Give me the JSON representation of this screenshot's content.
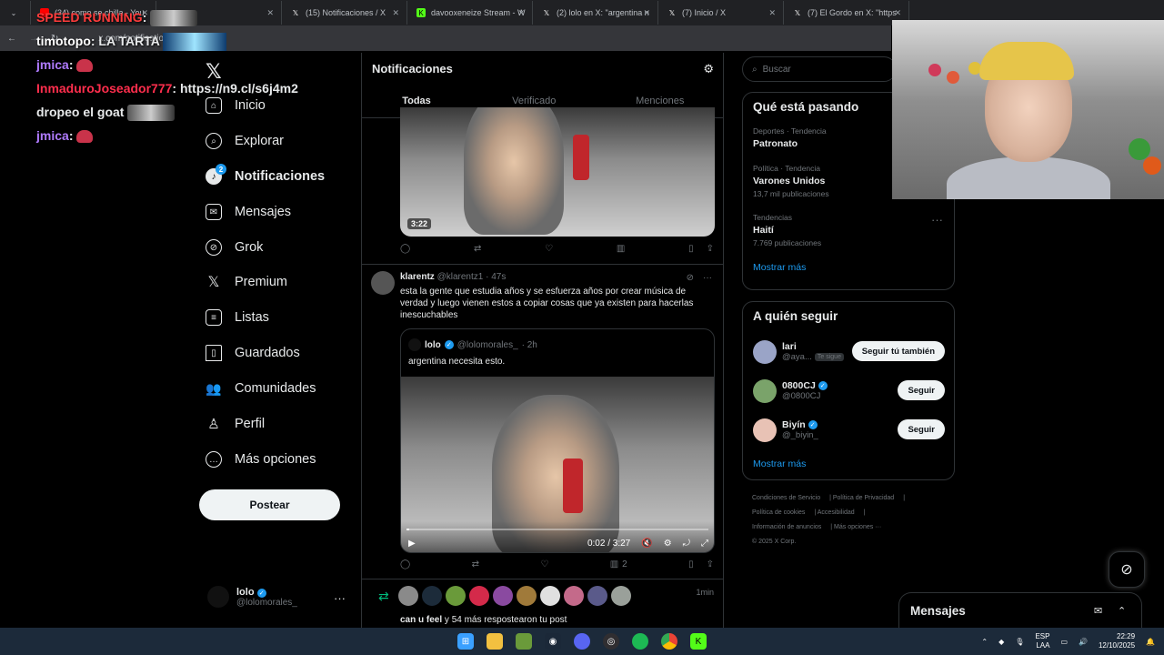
{
  "browser": {
    "tabs": [
      {
        "title": "(34) como se chilla - You",
        "color": "#ff0000"
      },
      {
        "title": "x",
        "color": "#444444"
      },
      {
        "title": "(15) Notificaciones / X",
        "color": "#000000"
      },
      {
        "title": "davooxeneize Stream - W",
        "color": "#53fc18"
      },
      {
        "title": "(2) lolo en X: \"argentina n",
        "color": "#000000"
      },
      {
        "title": "(7) Inicio / X",
        "color": "#000000"
      },
      {
        "title": "(7) El Gordo en X: \"https",
        "color": "#000000"
      }
    ],
    "url": "x.com/notifications"
  },
  "chat": [
    {
      "user": "SPEED RUNNING",
      "text": ":",
      "color": "#ff3b3b"
    },
    {
      "user": "timotopo",
      "text": ": LA TARTA",
      "color": "#ffffff"
    },
    {
      "user": "jmica",
      "text": ":",
      "color": "#b07bff"
    },
    {
      "user": "InmaduroJoseador777",
      "text": ": https://n9.cl/s6j4m2",
      "color": "#ff2e4d"
    },
    {
      "user": "",
      "text": "dropeo el goat",
      "color": "#ffffff"
    },
    {
      "user": "jmica",
      "text": ":",
      "color": "#b07bff"
    }
  ],
  "nav": {
    "items": [
      {
        "label": "Inicio",
        "icon": "home-icon"
      },
      {
        "label": "Explorar",
        "icon": "search-icon"
      },
      {
        "label": "Notificaciones",
        "icon": "bell-icon",
        "badge": "2"
      },
      {
        "label": "Mensajes",
        "icon": "mail-icon"
      },
      {
        "label": "Grok",
        "icon": "grok-icon"
      },
      {
        "label": "Premium",
        "icon": "x-logo-icon"
      },
      {
        "label": "Listas",
        "icon": "list-icon"
      },
      {
        "label": "Guardados",
        "icon": "bookmark-icon"
      },
      {
        "label": "Comunidades",
        "icon": "people-icon"
      },
      {
        "label": "Perfil",
        "icon": "person-icon"
      },
      {
        "label": "Más opciones",
        "icon": "more-circle-icon"
      }
    ],
    "post_label": "Postear",
    "account": {
      "name": "lolo",
      "handle": "@lolomorales_"
    }
  },
  "main": {
    "title": "Notificaciones",
    "tabs": [
      "Todas",
      "Verificado",
      "Menciones"
    ],
    "first_video_duration": "3:22",
    "tweet": {
      "name": "klarentz",
      "handle": "@klarentz1",
      "time": "· 47s",
      "text": "esta la gente que estudia años y se esfuerza años por crear música de verdad y luego vienen estos a copiar cosas que ya existen para hacerlas inescuchables",
      "quote": {
        "name": "lolo",
        "handle": "@lolomorales_",
        "time": "· 2h",
        "text": "argentina necesita esto.",
        "player_time": "0:02 / 3:27",
        "progress": 0.01
      },
      "views": "2"
    },
    "repost": {
      "time": "1min",
      "user": "can u feel",
      "text": " y 54 más respostearon tu post"
    }
  },
  "sidebar": {
    "search_placeholder": "Buscar",
    "trends_title": "Qué está pasando",
    "trends": [
      {
        "category": "Deportes · Tendencia",
        "name": "Patronato",
        "count": ""
      },
      {
        "category": "Política · Tendencia",
        "name": "Varones Unidos",
        "count": "13,7 mil publicaciones"
      },
      {
        "category": "Tendencias",
        "name": "Haití",
        "count": "7.769 publicaciones"
      }
    ],
    "show_more": "Mostrar más",
    "who_title": "A quién seguir",
    "who": [
      {
        "name": "lari",
        "handle": "@aya...",
        "follows_you": "Te sigue",
        "button": "Seguir tú también",
        "verified": false,
        "color": "#9aa4c7"
      },
      {
        "name": "0800CJ",
        "handle": "@0800CJ",
        "follows_you": "",
        "button": "Seguir",
        "verified": true,
        "color": "#7aa36a"
      },
      {
        "name": "Biyín",
        "handle": "@_biyin_",
        "follows_you": "",
        "button": "Seguir",
        "verified": true,
        "color": "#e8c2b5"
      }
    ],
    "footer": [
      "Condiciones de Servicio",
      "Política de Privacidad",
      "Política de cookies",
      "Accesibilidad",
      "Información de anuncios",
      "Más opciones ···",
      "© 2025 X Corp."
    ]
  },
  "dm_drawer": {
    "title": "Mensajes"
  },
  "taskbar": {
    "lang": "ESP",
    "lang2": "LAA",
    "time": "22:29",
    "date": "12/10/2025"
  }
}
